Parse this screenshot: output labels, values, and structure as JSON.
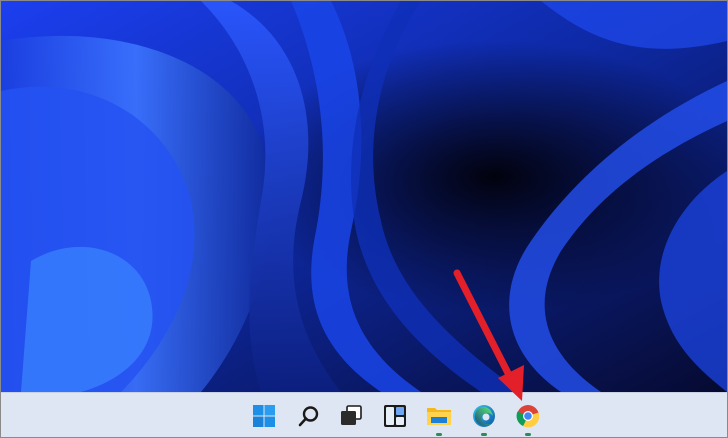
{
  "desktop": {
    "wallpaper": "windows-11-bloom-blue",
    "colors": {
      "deep": "#0a0a2a",
      "mid": "#1a3cd8",
      "light": "#5aa0ff",
      "bright": "#3060ff"
    }
  },
  "taskbar": {
    "background": "#dfe6f3",
    "running_indicator_color": "#2e8b57",
    "icons": [
      {
        "name": "start-icon",
        "running": false
      },
      {
        "name": "search-icon",
        "running": false
      },
      {
        "name": "task-view-icon",
        "running": false
      },
      {
        "name": "widgets-icon",
        "running": false
      },
      {
        "name": "file-explorer-icon",
        "running": true
      },
      {
        "name": "edge-icon",
        "running": true
      },
      {
        "name": "chrome-icon",
        "running": true
      }
    ]
  },
  "annotation": {
    "arrow_color": "#e3202a",
    "points_to": "chrome-icon"
  }
}
